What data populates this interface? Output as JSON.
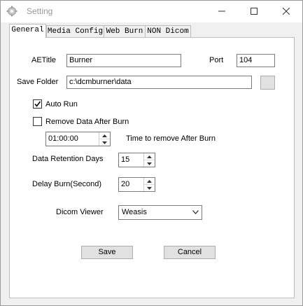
{
  "window": {
    "title": "Setting",
    "minimize_glyph": "—",
    "maximize_glyph": "☐",
    "close_glyph": "✕"
  },
  "tabs": [
    {
      "label": "General",
      "active": true
    },
    {
      "label": "Media Config",
      "active": false
    },
    {
      "label": "Web Burn",
      "active": false
    },
    {
      "label": "NON Dicom",
      "active": false
    }
  ],
  "general": {
    "aetitle_label": "AETitle",
    "aetitle_value": "Burner",
    "port_label": "Port",
    "port_value": "104",
    "save_folder_label": "Save Folder",
    "save_folder_value": "c:\\dcmburner\\data",
    "auto_run_label": "Auto Run",
    "auto_run_checked": true,
    "remove_data_label": "Remove Data After Burn",
    "remove_data_checked": false,
    "remove_time_value": "01:00:00",
    "remove_time_label": "Time to remove After Burn",
    "retention_label": "Data Retention Days",
    "retention_value": "15",
    "delay_label": "Delay Burn(Second)",
    "delay_value": "20",
    "viewer_label": "Dicom Viewer",
    "viewer_value": "Weasis",
    "save_button": "Save",
    "cancel_button": "Cancel"
  }
}
